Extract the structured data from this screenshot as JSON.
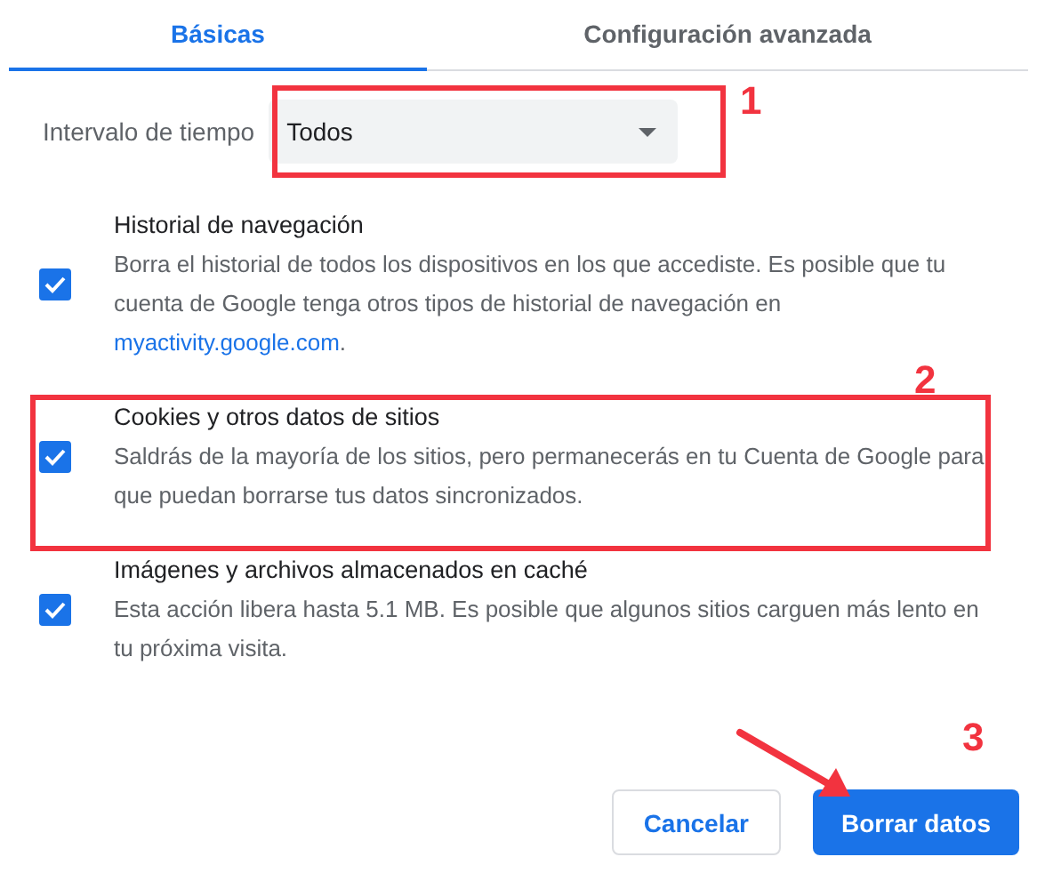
{
  "tabs": [
    {
      "label": "Básicas",
      "selected": true
    },
    {
      "label": "Configuración avanzada",
      "selected": false
    }
  ],
  "time_range": {
    "label": "Intervalo de tiempo",
    "value": "Todos"
  },
  "items": [
    {
      "title": "Historial de navegación",
      "description": "Borra el historial de todos los dispositivos en los que accediste. Es posible que tu cuenta de Google tenga otros tipos de historial de navegación en ",
      "link": "myactivity.google.com",
      "link_suffix": ".",
      "checked": true
    },
    {
      "title": "Cookies y otros datos de sitios",
      "description": "Saldrás de la mayoría de los sitios, pero permanecerás en tu Cuenta de Google para que puedan borrarse tus datos sincronizados.",
      "checked": true
    },
    {
      "title": "Imágenes y archivos almacenados en caché",
      "description": "Esta acción libera hasta 5.1 MB. Es posible que algunos sitios carguen más lento en tu próxima visita.",
      "checked": true
    }
  ],
  "buttons": [
    {
      "label": "Cancelar",
      "kind": "secondary"
    },
    {
      "label": "Borrar datos",
      "kind": "primary"
    }
  ],
  "annotations": [
    {
      "label": "1"
    },
    {
      "label": "2"
    },
    {
      "label": "3"
    }
  ]
}
